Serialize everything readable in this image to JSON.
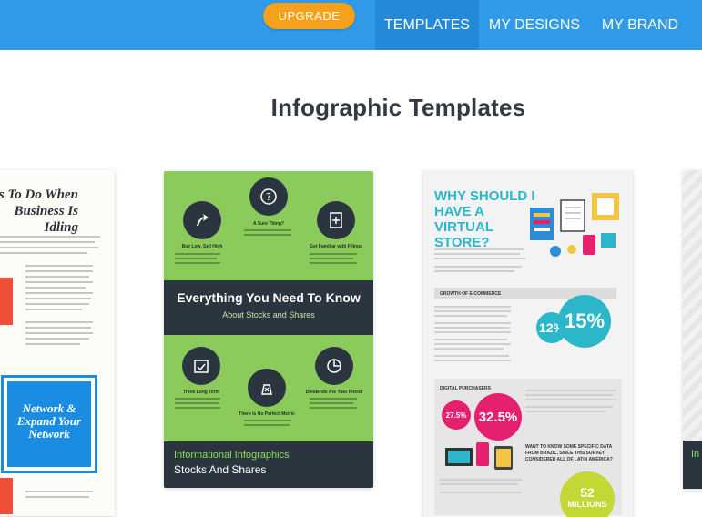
{
  "header": {
    "upgrade_label": "UPGRADE",
    "nav": [
      "TEMPLATES",
      "MY DESIGNS",
      "MY BRAND"
    ],
    "active_tab": "TEMPLATES"
  },
  "page_title": "Infographic Templates",
  "cards": [
    {
      "title_lines": [
        "s To Do When",
        "Business Is Idling"
      ],
      "inner_text_lines": [
        "Network &",
        "Expand Your",
        "Network"
      ]
    },
    {
      "headline": "Everything You Need To Know",
      "subline": "About Stocks and Shares",
      "circle_labels": [
        "Buy Low, Sell High",
        "A Sure Thing?",
        "Get Familiar with Filings",
        "Think Long Term",
        "There Is No Perfect Metric",
        "Dividends Are Your Friend"
      ],
      "category": "Informational Infographics",
      "name": "Stocks And Shares"
    },
    {
      "title_lines": [
        "WHY SHOULD I",
        "HAVE A VIRTUAL",
        "STORE?"
      ],
      "section1": "GROWTH OF E-COMMERCE",
      "stat_a": "12%",
      "stat_b": "15%",
      "section2": "DIGITAL PURCHASERS",
      "stat_c": "27.5%",
      "stat_d": "32.5%",
      "question": "WANT TO KNOW SOME SPECIFIC DATA FROM BRAZIL, SINCE THIS SURVEY CONSIDERED ALL OF LATIN AMERICA?",
      "stat_e": "52",
      "stat_e_unit": "MILLIONS"
    },
    {
      "partial_label": "In"
    }
  ],
  "colors": {
    "topbar": "#2f9ae8",
    "active_tab": "#2389d8",
    "upgrade": "#f7a01a",
    "card_green": "#8bcb5c",
    "card_dark": "#2a3540",
    "teal": "#2bb7c9",
    "magenta": "#e4206f"
  }
}
